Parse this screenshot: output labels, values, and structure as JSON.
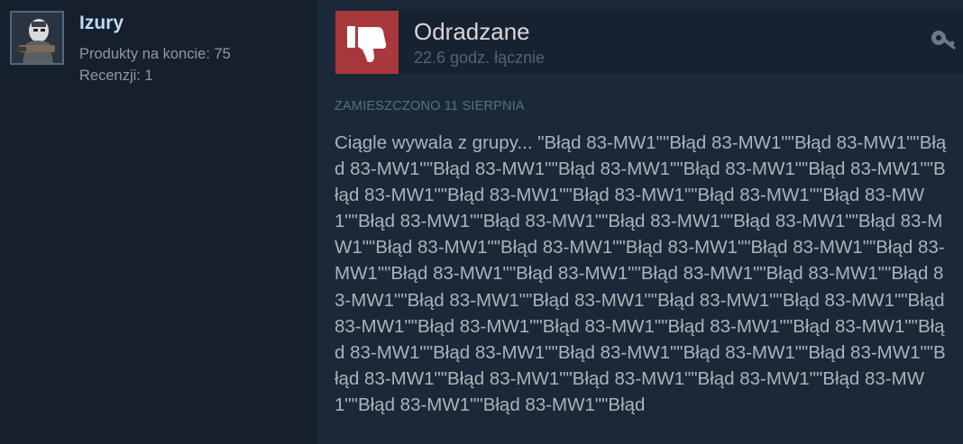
{
  "author": {
    "name": "Izury",
    "products_text": "Produkty na koncie: 75",
    "reviews_text": "Recenzji: 1"
  },
  "review": {
    "verdict": "Odradzane",
    "hours": "22.6 godz. łącznie",
    "posted": "ZAMIESZCZONO 11 SIERPNIA",
    "body": "Ciągle wywala z grupy... \"Błąd 83-MW1\"\"Błąd 83-MW1\"\"Błąd 83-MW1\"\"Błąd 83-MW1\"\"Błąd 83-MW1\"\"Błąd 83-MW1\"\"Błąd 83-MW1\"\"Błąd 83-MW1\"\"Błąd 83-MW1\"\"Błąd 83-MW1\"\"Błąd 83-MW1\"\"Błąd 83-MW1\"\"Błąd 83-MW1\"\"Błąd 83-MW1\"\"Błąd 83-MW1\"\"Błąd 83-MW1\"\"Błąd 83-MW1\"\"Błąd 83-MW1\"\"Błąd 83-MW1\"\"Błąd 83-MW1\"\"Błąd 83-MW1\"\"Błąd 83-MW1\"\"Błąd 83-MW1\"\"Błąd 83-MW1\"\"Błąd 83-MW1\"\"Błąd 83-MW1\"\"Błąd 83-MW1\"\"Błąd 83-MW1\"\"Błąd 83-MW1\"\"Błąd 83-MW1\"\"Błąd 83-MW1\"\"Błąd 83-MW1\"\"Błąd 83-MW1\"\"Błąd 83-MW1\"\"Błąd 83-MW1\"\"Błąd 83-MW1\"\"Błąd 83-MW1\"\"Błąd 83-MW1\"\"Błąd 83-MW1\"\"Błąd 83-MW1\"\"Błąd 83-MW1\"\"Błąd 83-MW1\"\"Błąd 83-MW1\"\"Błąd 83-MW1\"\"Błąd 83-MW1\"\"Błąd 83-MW1\"\"Błąd 83-MW1\"\"Błąd 83-MW1\"\"Błąd 83-MW1\"\"Błąd"
  },
  "icons": {
    "verdict": "thumbs-down-icon",
    "developer_key": "key-icon",
    "avatar": "user-avatar"
  },
  "colors": {
    "background": "#1b2838",
    "author_panel": "#16202d",
    "negative": "#a8383b",
    "username": "#c1dbf4",
    "verdict_text": "#d6d7d8",
    "muted": "#8f98a0"
  }
}
